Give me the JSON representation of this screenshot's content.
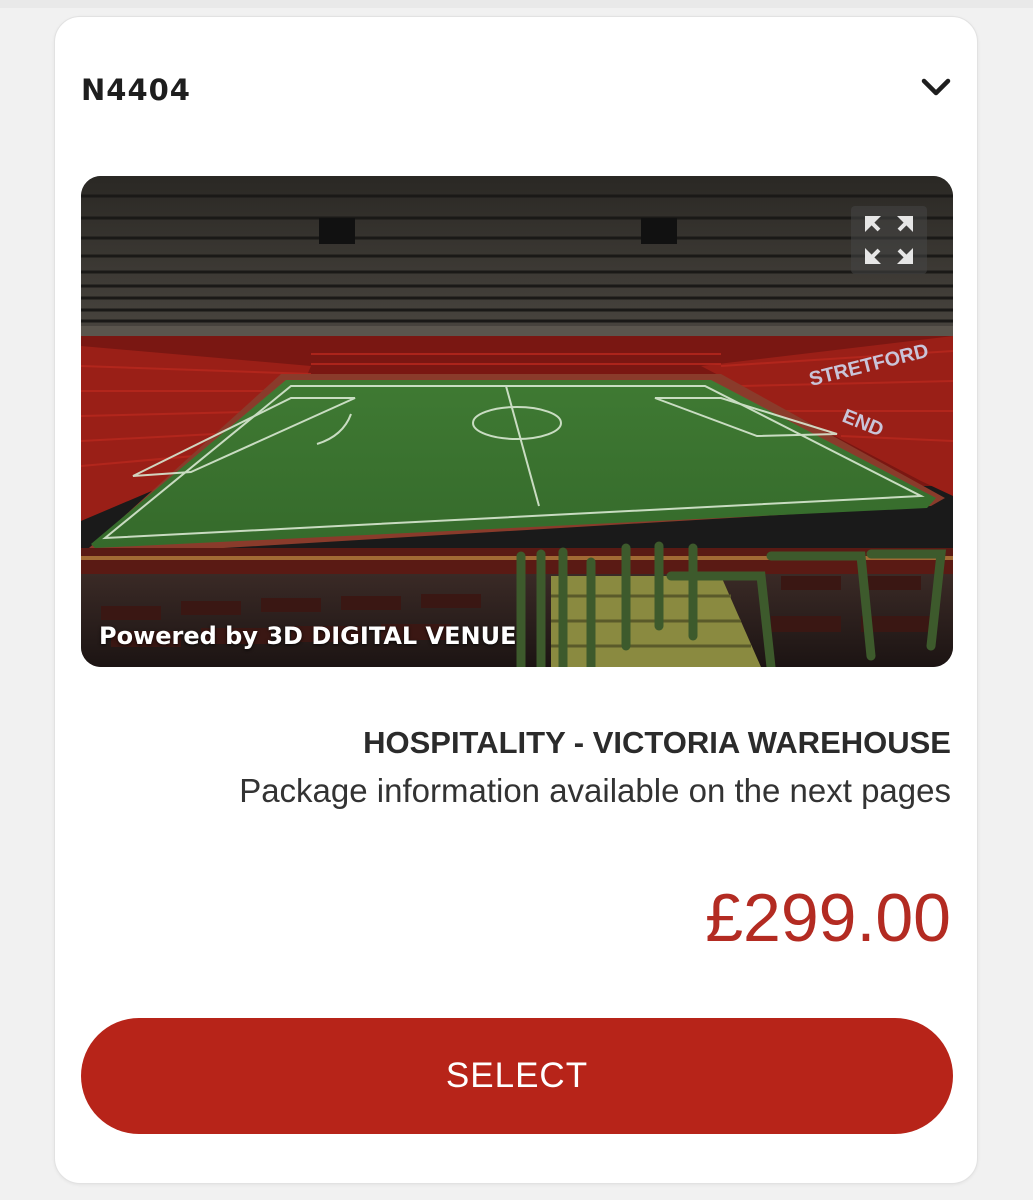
{
  "seat": {
    "code": "N4404"
  },
  "viewer": {
    "powered_by": "Powered by 3D DIGITAL VENUE",
    "fullscreen_icon": "expand-icon"
  },
  "package": {
    "title": "HOSPITALITY - VICTORIA WAREHOUSE",
    "subtitle": "Package information available on the next pages"
  },
  "price": {
    "amount": "£299.00",
    "color": "#b32b22"
  },
  "actions": {
    "select_label": "SELECT",
    "select_color": "#b72419"
  }
}
